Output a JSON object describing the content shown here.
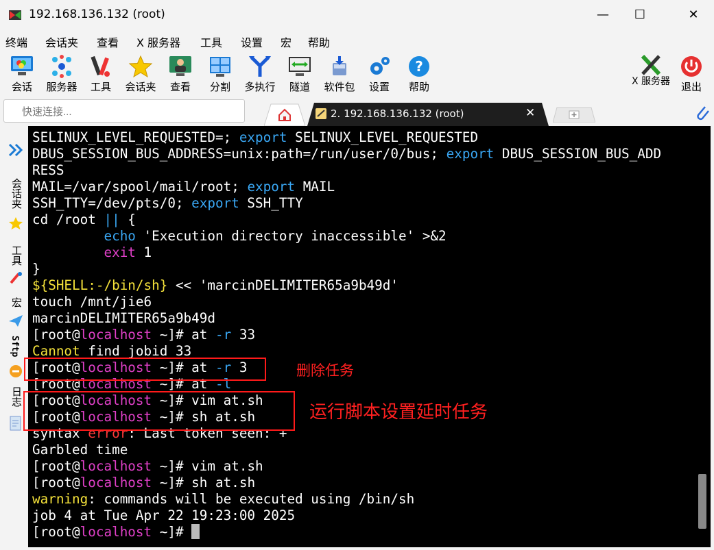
{
  "window": {
    "title": "192.168.136.132 (root)",
    "minimize": "—",
    "maximize": "☐",
    "close": "✕"
  },
  "menu": [
    "终端",
    "会话夹",
    "查看",
    "X 服务器",
    "工具",
    "设置",
    "宏",
    "帮助"
  ],
  "toolbar": {
    "items": [
      "会话",
      "服务器",
      "工具",
      "会话夹",
      "查看",
      "分割",
      "多执行",
      "隧道",
      "软件包",
      "设置",
      "帮助"
    ],
    "xserver": "X 服务器",
    "exit": "退出"
  },
  "quick_connect": {
    "placeholder": "快速连接..."
  },
  "tabs": {
    "active": "2. 192.168.136.132 (root)",
    "close": "✕"
  },
  "sidebar": [
    "会话夹",
    "工具",
    "宏",
    "Sftp",
    "日志"
  ],
  "terminal": {
    "lines": [
      [
        [
          "SELINUX_LEVEL_REQUESTED=; ",
          ""
        ],
        [
          "export",
          "b"
        ],
        [
          " SELINUX_LEVEL_REQUESTED",
          ""
        ]
      ],
      [
        [
          "DBUS_SESSION_BUS_ADDRESS=unix:path=/run/user/0/bus; ",
          ""
        ],
        [
          "export",
          "b"
        ],
        [
          " DBUS_SESSION_BUS_ADD",
          ""
        ]
      ],
      [
        [
          "RESS",
          ""
        ]
      ],
      [
        [
          "MAIL=/var/spool/mail/root; ",
          ""
        ],
        [
          "export",
          "b"
        ],
        [
          " MAIL",
          ""
        ]
      ],
      [
        [
          "SSH_TTY=/dev/pts/0; ",
          ""
        ],
        [
          "export",
          "b"
        ],
        [
          " SSH_TTY",
          ""
        ]
      ],
      [
        [
          "cd /root ",
          ""
        ],
        [
          "||",
          "b"
        ],
        [
          " {",
          ""
        ]
      ],
      [
        [
          "         ",
          ""
        ],
        [
          "echo",
          "b"
        ],
        [
          " 'Execution directory inaccessible' >&2",
          ""
        ]
      ],
      [
        [
          "         ",
          ""
        ],
        [
          "exit",
          "p"
        ],
        [
          " 1",
          ""
        ]
      ],
      [
        [
          "}",
          ""
        ]
      ],
      [
        [
          "${SHELL:-/bin/sh}",
          "y"
        ],
        [
          " << 'marcinDELIMITER65a9b49d'",
          ""
        ]
      ],
      [
        [
          "touch /mnt/jie6",
          ""
        ]
      ],
      [
        [
          "marcinDELIMITER65a9b49d",
          ""
        ]
      ],
      [
        [
          "[root@",
          ""
        ],
        [
          "localhost",
          "p"
        ],
        [
          " ~]# at ",
          ""
        ],
        [
          "-r",
          "b"
        ],
        [
          " 33",
          ""
        ]
      ],
      [
        [
          "Cannot",
          "y"
        ],
        [
          " find jobid 33",
          ""
        ]
      ],
      [
        [
          "[root@",
          ""
        ],
        [
          "localhost",
          "p"
        ],
        [
          " ~]# at ",
          ""
        ],
        [
          "-r",
          "b"
        ],
        [
          " 3",
          ""
        ]
      ],
      [
        [
          "[root@",
          ""
        ],
        [
          "localhost",
          "p"
        ],
        [
          " ~]# at ",
          ""
        ],
        [
          "-l",
          "b"
        ]
      ],
      [
        [
          "[root@",
          ""
        ],
        [
          "localhost",
          "p"
        ],
        [
          " ~]# vim at.sh",
          ""
        ]
      ],
      [
        [
          "[root@",
          ""
        ],
        [
          "localhost",
          "p"
        ],
        [
          " ~]# sh at.sh",
          ""
        ]
      ],
      [
        [
          "syntax ",
          ""
        ],
        [
          "error",
          "r"
        ],
        [
          ": Last token seen: +",
          ""
        ]
      ],
      [
        [
          "Garbled time",
          ""
        ]
      ],
      [
        [
          "[root@",
          ""
        ],
        [
          "localhost",
          "p"
        ],
        [
          " ~]# vim at.sh",
          ""
        ]
      ],
      [
        [
          "[root@",
          ""
        ],
        [
          "localhost",
          "p"
        ],
        [
          " ~]# sh at.sh",
          ""
        ]
      ],
      [
        [
          "warning",
          "y"
        ],
        [
          ": commands will be executed using /bin/sh",
          ""
        ]
      ],
      [
        [
          "job 4 at Tue Apr 22 19:23:00 2025",
          ""
        ]
      ],
      [
        [
          "[root@",
          ""
        ],
        [
          "localhost",
          "p"
        ],
        [
          " ~]# ",
          ""
        ]
      ]
    ]
  },
  "annotations": {
    "delete": "删除任务",
    "run": "运行脚本设置延时任务"
  }
}
